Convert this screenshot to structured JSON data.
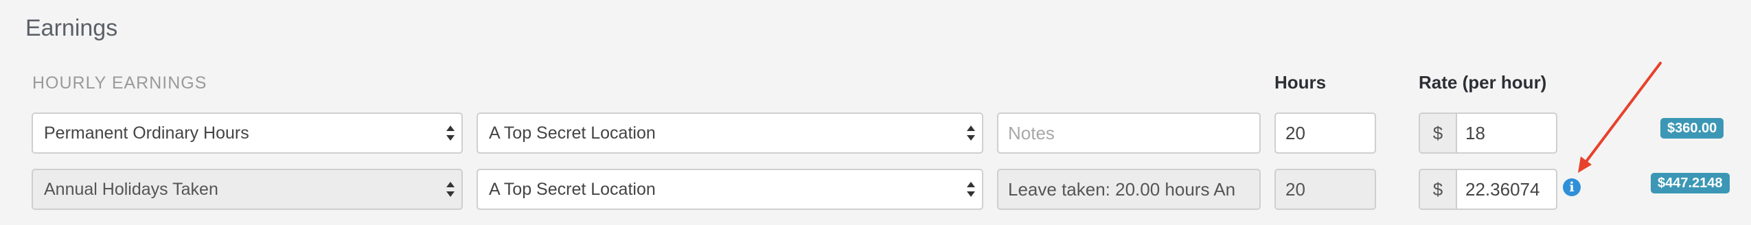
{
  "section": {
    "title": "Earnings"
  },
  "subheading": "HOURLY EARNINGS",
  "columns": {
    "hours": "Hours",
    "rate": "Rate (per hour)"
  },
  "rows": [
    {
      "type": "Permanent Ordinary Hours",
      "location": "A Top Secret Location",
      "notes_placeholder": "Notes",
      "notes": "",
      "hours": "20",
      "currency": "$",
      "rate": "18",
      "amount": "$360.00"
    },
    {
      "type": "Annual Holidays Taken",
      "location": "A Top Secret Location",
      "notes": "Leave taken: 20.00 hours An",
      "hours": "20",
      "currency": "$",
      "rate": "22.36074",
      "amount": "$447.2148"
    }
  ],
  "colors": {
    "badge": "#3b97b5",
    "info_icon": "#2f8fd8",
    "annotation_arrow": "#e8412c"
  },
  "icons": {
    "info": "info-icon",
    "select_arrows": "updown-arrows-icon"
  }
}
